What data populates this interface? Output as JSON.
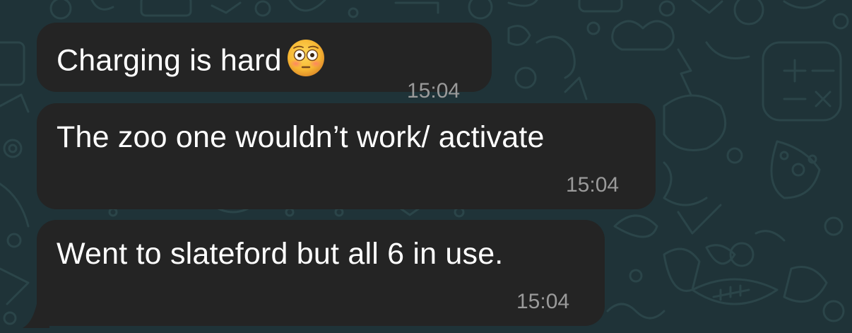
{
  "chat": {
    "messages": [
      {
        "text": "Charging is hard",
        "emoji": "flushed-face-emoji",
        "time": "15:04"
      },
      {
        "text": "The zoo one wouldn’t work/ activate",
        "time": "15:04"
      },
      {
        "text": "Went to slateford but all 6 in use.",
        "time": "15:04"
      }
    ]
  },
  "colors": {
    "background": "#1f3338",
    "wallpaper_doodle": "#2a4449",
    "bubble": "#242424",
    "text": "#ffffff",
    "timestamp": "#9a9a9a"
  }
}
